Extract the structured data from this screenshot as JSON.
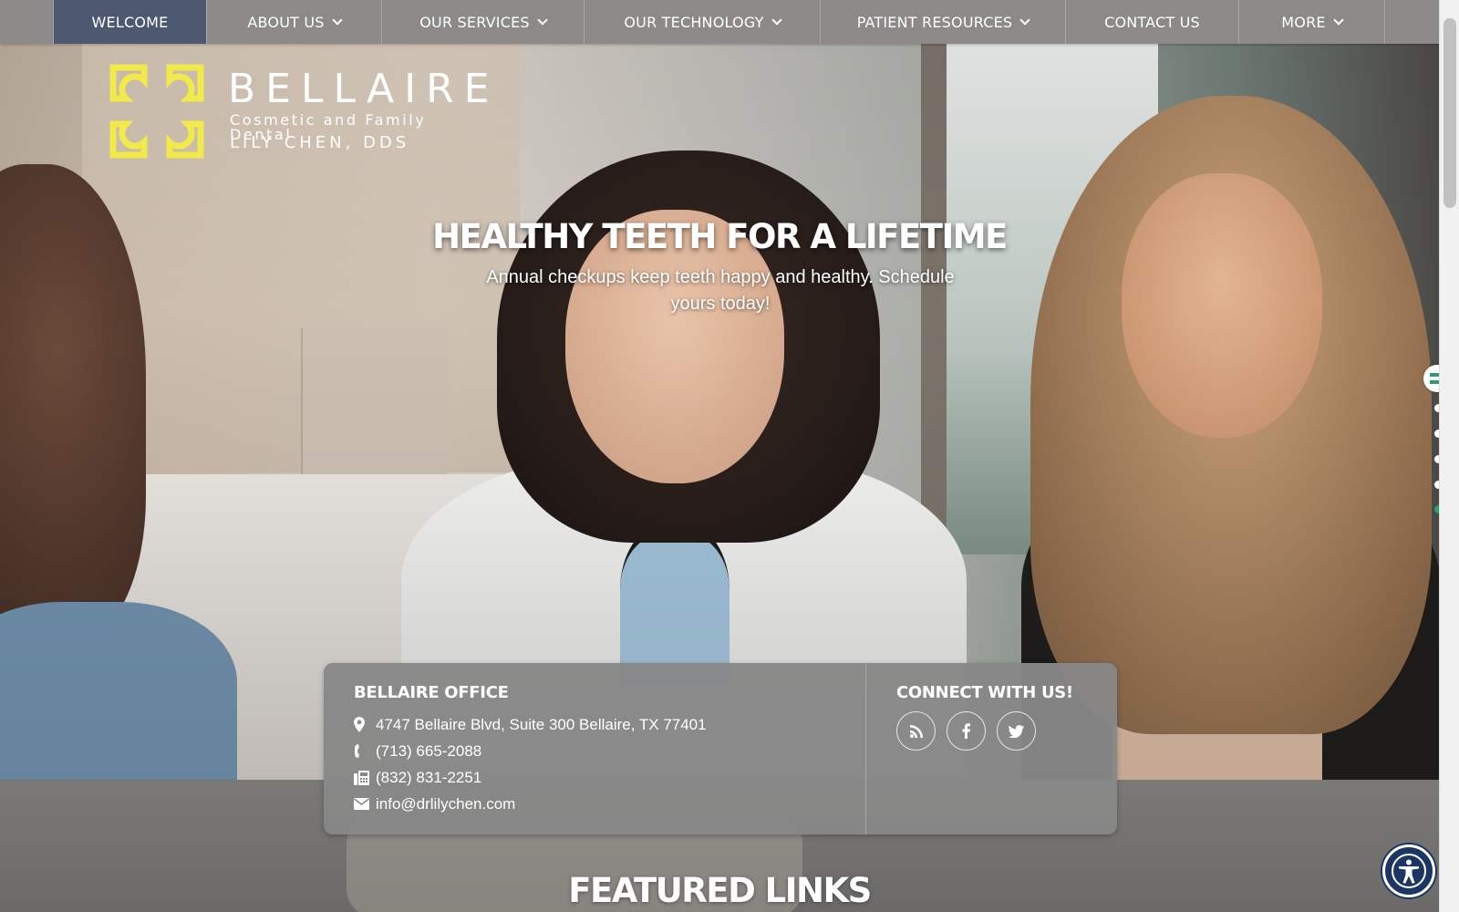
{
  "nav": {
    "items": [
      {
        "label": "WELCOME",
        "dropdown": false,
        "active": true
      },
      {
        "label": "ABOUT US",
        "dropdown": true
      },
      {
        "label": "OUR SERVICES",
        "dropdown": true
      },
      {
        "label": "OUR TECHNOLOGY",
        "dropdown": true
      },
      {
        "label": "PATIENT RESOURCES",
        "dropdown": true
      },
      {
        "label": "CONTACT US",
        "dropdown": false
      },
      {
        "label": "MORE",
        "dropdown": true
      }
    ]
  },
  "logo": {
    "name": "BELLAIRE",
    "tagline": "Cosmetic and Family Dental",
    "doctor": "LILY CHEN, DDS",
    "mark_color": "#f2ea4a"
  },
  "hero": {
    "title": "HEALTHY TEETH FOR A LIFETIME",
    "subtitle": "Annual checkups keep teeth happy and healthy. Schedule yours today!"
  },
  "office": {
    "heading": "BELLAIRE OFFICE",
    "address": "4747 Bellaire Blvd, Suite 300 Bellaire, TX 77401",
    "phone": "(713) 665-2088",
    "fax": "(832) 831-2251",
    "email": "info@drlilychen.com"
  },
  "connect": {
    "heading": "CONNECT WITH US!",
    "icons": [
      "rss-icon",
      "facebook-icon",
      "twitter-icon"
    ]
  },
  "featured": {
    "heading": "FEATURED LINKS"
  },
  "colors": {
    "nav_bg": "#8b8a88",
    "nav_active": "#4c5770",
    "accent_green": "#2e9e6e",
    "a11y_blue": "#1b3565"
  }
}
